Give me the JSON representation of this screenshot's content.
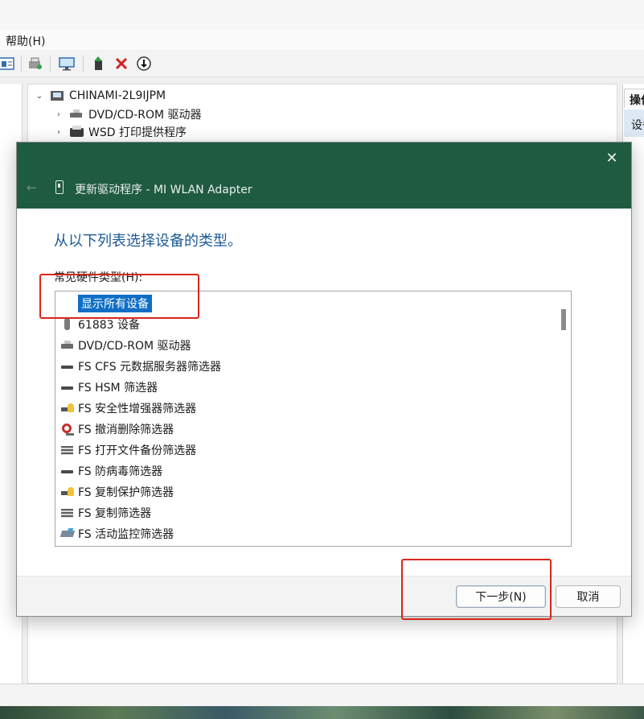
{
  "menubar": {
    "help_label": "帮助(H)"
  },
  "toolbar": {
    "icons": [
      "properties-icon",
      "scan-hardware-icon",
      "monitor-icon",
      "update-driver-icon",
      "uninstall-icon",
      "disable-icon"
    ]
  },
  "tree": {
    "computer_name": "CHINAMI-2L9IJPM",
    "items": [
      {
        "label": "DVD/CD-ROM 驱动器",
        "icon": "dvd-drive-icon"
      },
      {
        "label": "WSD 打印提供程序",
        "icon": "printer-icon"
      }
    ]
  },
  "right_panel": {
    "header": "操作",
    "item": "设备"
  },
  "dialog": {
    "title": "更新驱动程序 - MI WLAN Adapter",
    "heading": "从以下列表选择设备的类型。",
    "list_label": "常见硬件类型(H):",
    "list_items": [
      {
        "label": "显示所有设备",
        "icon": "none",
        "selected": true
      },
      {
        "label": "61883 设备",
        "icon": "usb-device-icon",
        "selected": false
      },
      {
        "label": "DVD/CD-ROM 驱动器",
        "icon": "dvd-drive-icon",
        "selected": false
      },
      {
        "label": "FS CFS 元数据服务器筛选器",
        "icon": "filter-icon",
        "selected": false
      },
      {
        "label": "FS HSM 筛选器",
        "icon": "filter-icon",
        "selected": false
      },
      {
        "label": "FS 安全性增强器筛选器",
        "icon": "security-key-icon",
        "selected": false
      },
      {
        "label": "FS 撤消删除筛选器",
        "icon": "undelete-icon",
        "selected": false
      },
      {
        "label": "FS 打开文件备份筛选器",
        "icon": "backup-stack-icon",
        "selected": false
      },
      {
        "label": "FS 防病毒筛选器",
        "icon": "filter-icon",
        "selected": false
      },
      {
        "label": "FS 复制保护筛选器",
        "icon": "security-key-icon",
        "selected": false
      },
      {
        "label": "FS 复制筛选器",
        "icon": "backup-stack-icon",
        "selected": false
      },
      {
        "label": "FS 活动监控筛选器",
        "icon": "monitor-filter-icon",
        "selected": false
      }
    ],
    "next_label": "下一步(N)",
    "cancel_label": "取消"
  },
  "colors": {
    "dialog_header": "#1f5b41",
    "heading_blue": "#1d5a96",
    "selection": "#0f6fc6",
    "annotation_red": "#d9261c"
  }
}
